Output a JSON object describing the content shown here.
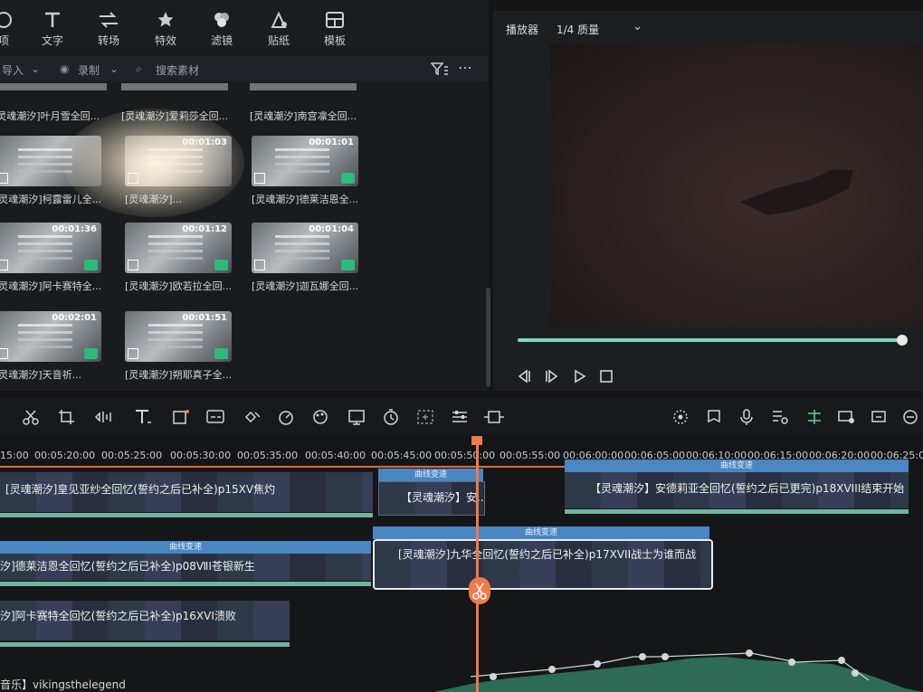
{
  "toolbar": {
    "items": [
      {
        "label": "项",
        "icon": "media-icon"
      },
      {
        "label": "文字",
        "icon": "text-icon"
      },
      {
        "label": "转场",
        "icon": "transition-icon"
      },
      {
        "label": "特效",
        "icon": "effects-icon"
      },
      {
        "label": "滤镜",
        "icon": "filter-icon"
      },
      {
        "label": "贴纸",
        "icon": "sticker-icon"
      },
      {
        "label": "模板",
        "icon": "template-icon"
      }
    ]
  },
  "media": {
    "import_label": "导入",
    "record_label": "录制",
    "search_placeholder": "搜索素材",
    "top_labels": [
      "[灵魂潮汐]叶月雪全回...",
      "[灵魂潮汐]爱莉莎全回...",
      "[灵魂潮汐]南宫凛全回..."
    ],
    "clips": [
      {
        "duration": "",
        "label": "[灵魂潮汐]柯露雷儿全..."
      },
      {
        "duration": "00:01:03",
        "label": "[灵魂潮汐]..."
      },
      {
        "duration": "00:01:01",
        "label": "[灵魂潮汐]德莱洁恩全..."
      },
      {
        "duration": "00:01:36",
        "label": "[灵魂潮汐]阿卡赛特全..."
      },
      {
        "duration": "00:01:12",
        "label": "[灵魂潮汐]欧若拉全回..."
      },
      {
        "duration": "00:01:04",
        "label": "[灵魂潮汐]迦瓦娜全回..."
      },
      {
        "duration": "00:02:01",
        "label": "[灵魂潮汐]天音祈..."
      },
      {
        "duration": "00:01:51",
        "label": "[灵魂潮汐]朔耶真子全..."
      }
    ]
  },
  "player": {
    "label": "播放器",
    "quality": "1/4 质量",
    "progress": 0.99
  },
  "ruler": {
    "ticks": [
      "15:00",
      "00:05:20:00",
      "00:05:25:00",
      "00:05:30:00",
      "00:05:35:00",
      "00:05:40:00",
      "00:05:45:00",
      "00:05:50:00",
      "00:05:55:00",
      "00:06:00:00",
      "00:06:05:00",
      "00:06:10:00",
      "00:06:15:00",
      "00:06:20:00",
      "00:06:25:00"
    ]
  },
  "timeline": {
    "clips": [
      {
        "title": "[灵魂潮汐]皇见亚纱全回忆(誓约之后已补全)p15ⅩⅤ焦灼"
      },
      {
        "title": "【灵魂潮汐】安..."
      },
      {
        "title": "【灵魂潮汐】安德莉亚全回忆(誓约之后已更完)p18ⅩⅤⅠⅠⅠ结束开始"
      },
      {
        "title": "汐]德莱洁恩全回忆(誓约之后已补全)p08ⅦⅠ苍银新生"
      },
      {
        "title": "[灵魂潮汐]九华全回忆(誓约之后已补全)p17ⅩⅤⅠⅠ战士为谁而战"
      },
      {
        "title": "汐]阿卡赛特全回忆(誓约之后已补全)p16ⅩⅤⅠ溃败"
      }
    ],
    "transition_label": "曲线变速",
    "audio_label": "音乐】vikingsthelegend"
  }
}
